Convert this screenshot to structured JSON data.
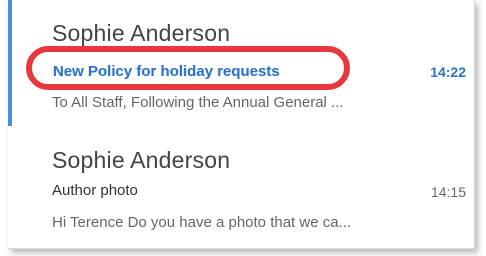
{
  "mail_list": {
    "items": [
      {
        "sender": "Sophie Anderson",
        "subject": "New Policy for holiday requests",
        "time": "14:22",
        "preview": "To All Staff,   Following the Annual General ...",
        "selected": true
      },
      {
        "sender": "Sophie Anderson",
        "subject": "Author photo",
        "time": "14:15",
        "preview": "Hi Terence   Do you have a photo that we ca...",
        "selected": false
      }
    ]
  },
  "colors": {
    "accent": "#4a90d9",
    "subject_selected": "#2b73c2",
    "highlight": "#e8383d"
  }
}
